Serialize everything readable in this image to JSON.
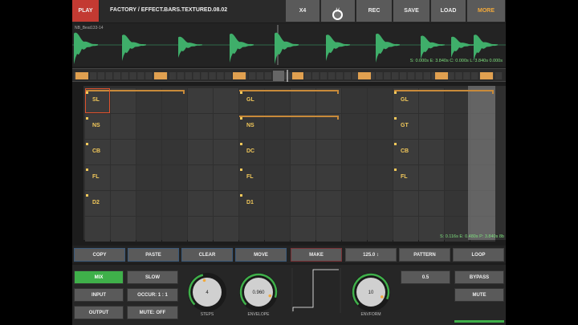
{
  "topbar": {
    "play": "PLAY",
    "preset": "FACTORY / EFFECT.BARS.TEXTURED.08.02",
    "buttons": [
      "X4",
      "½",
      "REC",
      "SAVE",
      "LOAD",
      "MORE"
    ]
  },
  "waveform": {
    "sample_name": "NB_Beat133-14",
    "readout": "S: 0.000s E: 3.840s C: 0.000s L: 3.840s 0.000s"
  },
  "grid": {
    "groups": [
      {
        "labels": [
          "SL",
          "NS",
          "CB",
          "FL",
          "D2"
        ]
      },
      {
        "labels": [
          "GL",
          "NS",
          "DC",
          "FL",
          "D1"
        ]
      },
      {
        "labels": [
          "GL",
          "GT",
          "CB",
          "FL"
        ]
      }
    ],
    "readout": "S: 0.116s E: 0.480s P: 3.840s 8b"
  },
  "edit_row": [
    "COPY",
    "PASTE",
    "CLEAR",
    "MOVE",
    "MAKE",
    "125.0 ↕",
    "PATTERN",
    "LOOP"
  ],
  "bottom": {
    "left_buttons": [
      "MIX",
      "INPUT",
      "OUTPUT"
    ],
    "mid_buttons": [
      "SLOW",
      "OCCUR: 1 : 1",
      "MUTE: OFF"
    ],
    "knobs": [
      {
        "value": "4",
        "label": "STEPS",
        "level": 0.45
      },
      {
        "value": "0.960",
        "label": "ENVELOPE",
        "level": 0.9
      },
      {
        "value": "10",
        "label": "ENVFORM",
        "level": 0.92
      }
    ],
    "value_box": "0.5",
    "right_buttons": [
      "BYPASS",
      "MUTE"
    ]
  },
  "colors": {
    "accent": "#f2a93b",
    "wave": "#3fae6a",
    "play": "#c33a32",
    "select": "#3fb04a",
    "label": "#f2c85a"
  }
}
